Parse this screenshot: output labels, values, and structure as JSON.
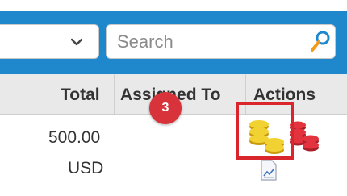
{
  "toolbar": {
    "select": {
      "value": ""
    },
    "search": {
      "placeholder": "Search"
    }
  },
  "table": {
    "columns": [
      "Total",
      "Assigned To",
      "Actions"
    ],
    "rows": [
      {
        "total_amount": "500.00",
        "total_currency": "USD"
      }
    ]
  },
  "badge": {
    "label": "3"
  },
  "colors": {
    "toolbar": "#1f87cc",
    "badge": "#d8323a",
    "highlight": "#d8262c",
    "gold": "#e7c21a",
    "red_coins": "#e2333f"
  },
  "icons": [
    "chevron-down-icon",
    "search-icon",
    "gold-coins-icon",
    "red-coins-icon",
    "document-chart-icon"
  ]
}
